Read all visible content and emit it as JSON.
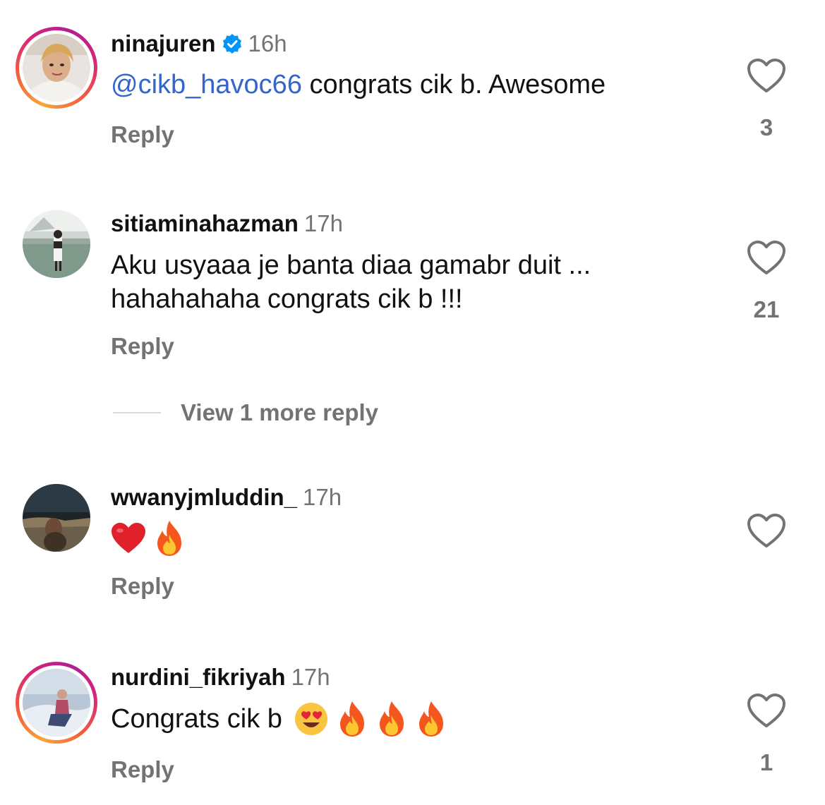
{
  "comments": [
    {
      "username": "ninajuren",
      "verified": true,
      "time": "16h",
      "mention": "@cikb_havoc66",
      "text": " congrats cik b. Awesome",
      "reply_label": "Reply",
      "like_count": "3",
      "story_ring": true
    },
    {
      "username": "sitiaminahazman",
      "time": "17h",
      "text_line1": "Aku usyaaa je banta diaa gamabr duit ...",
      "text_line2": "hahahahaha congrats cik b !!!",
      "reply_label": "Reply",
      "like_count": "21",
      "view_more": "View 1 more reply"
    },
    {
      "username": "wwanyjmluddin_",
      "time": "17h",
      "emojis": [
        "red-heart",
        "fire"
      ],
      "reply_label": "Reply"
    },
    {
      "username": "nurdini_fikriyah",
      "time": "17h",
      "text": "Congrats cik b",
      "emojis": [
        "heart-eyes",
        "fire",
        "fire",
        "fire"
      ],
      "reply_label": "Reply",
      "like_count": "1",
      "story_ring": true
    }
  ],
  "colors": {
    "mention": "#3366cc",
    "secondary_text": "#737373",
    "verified_badge": "#0095f6"
  }
}
